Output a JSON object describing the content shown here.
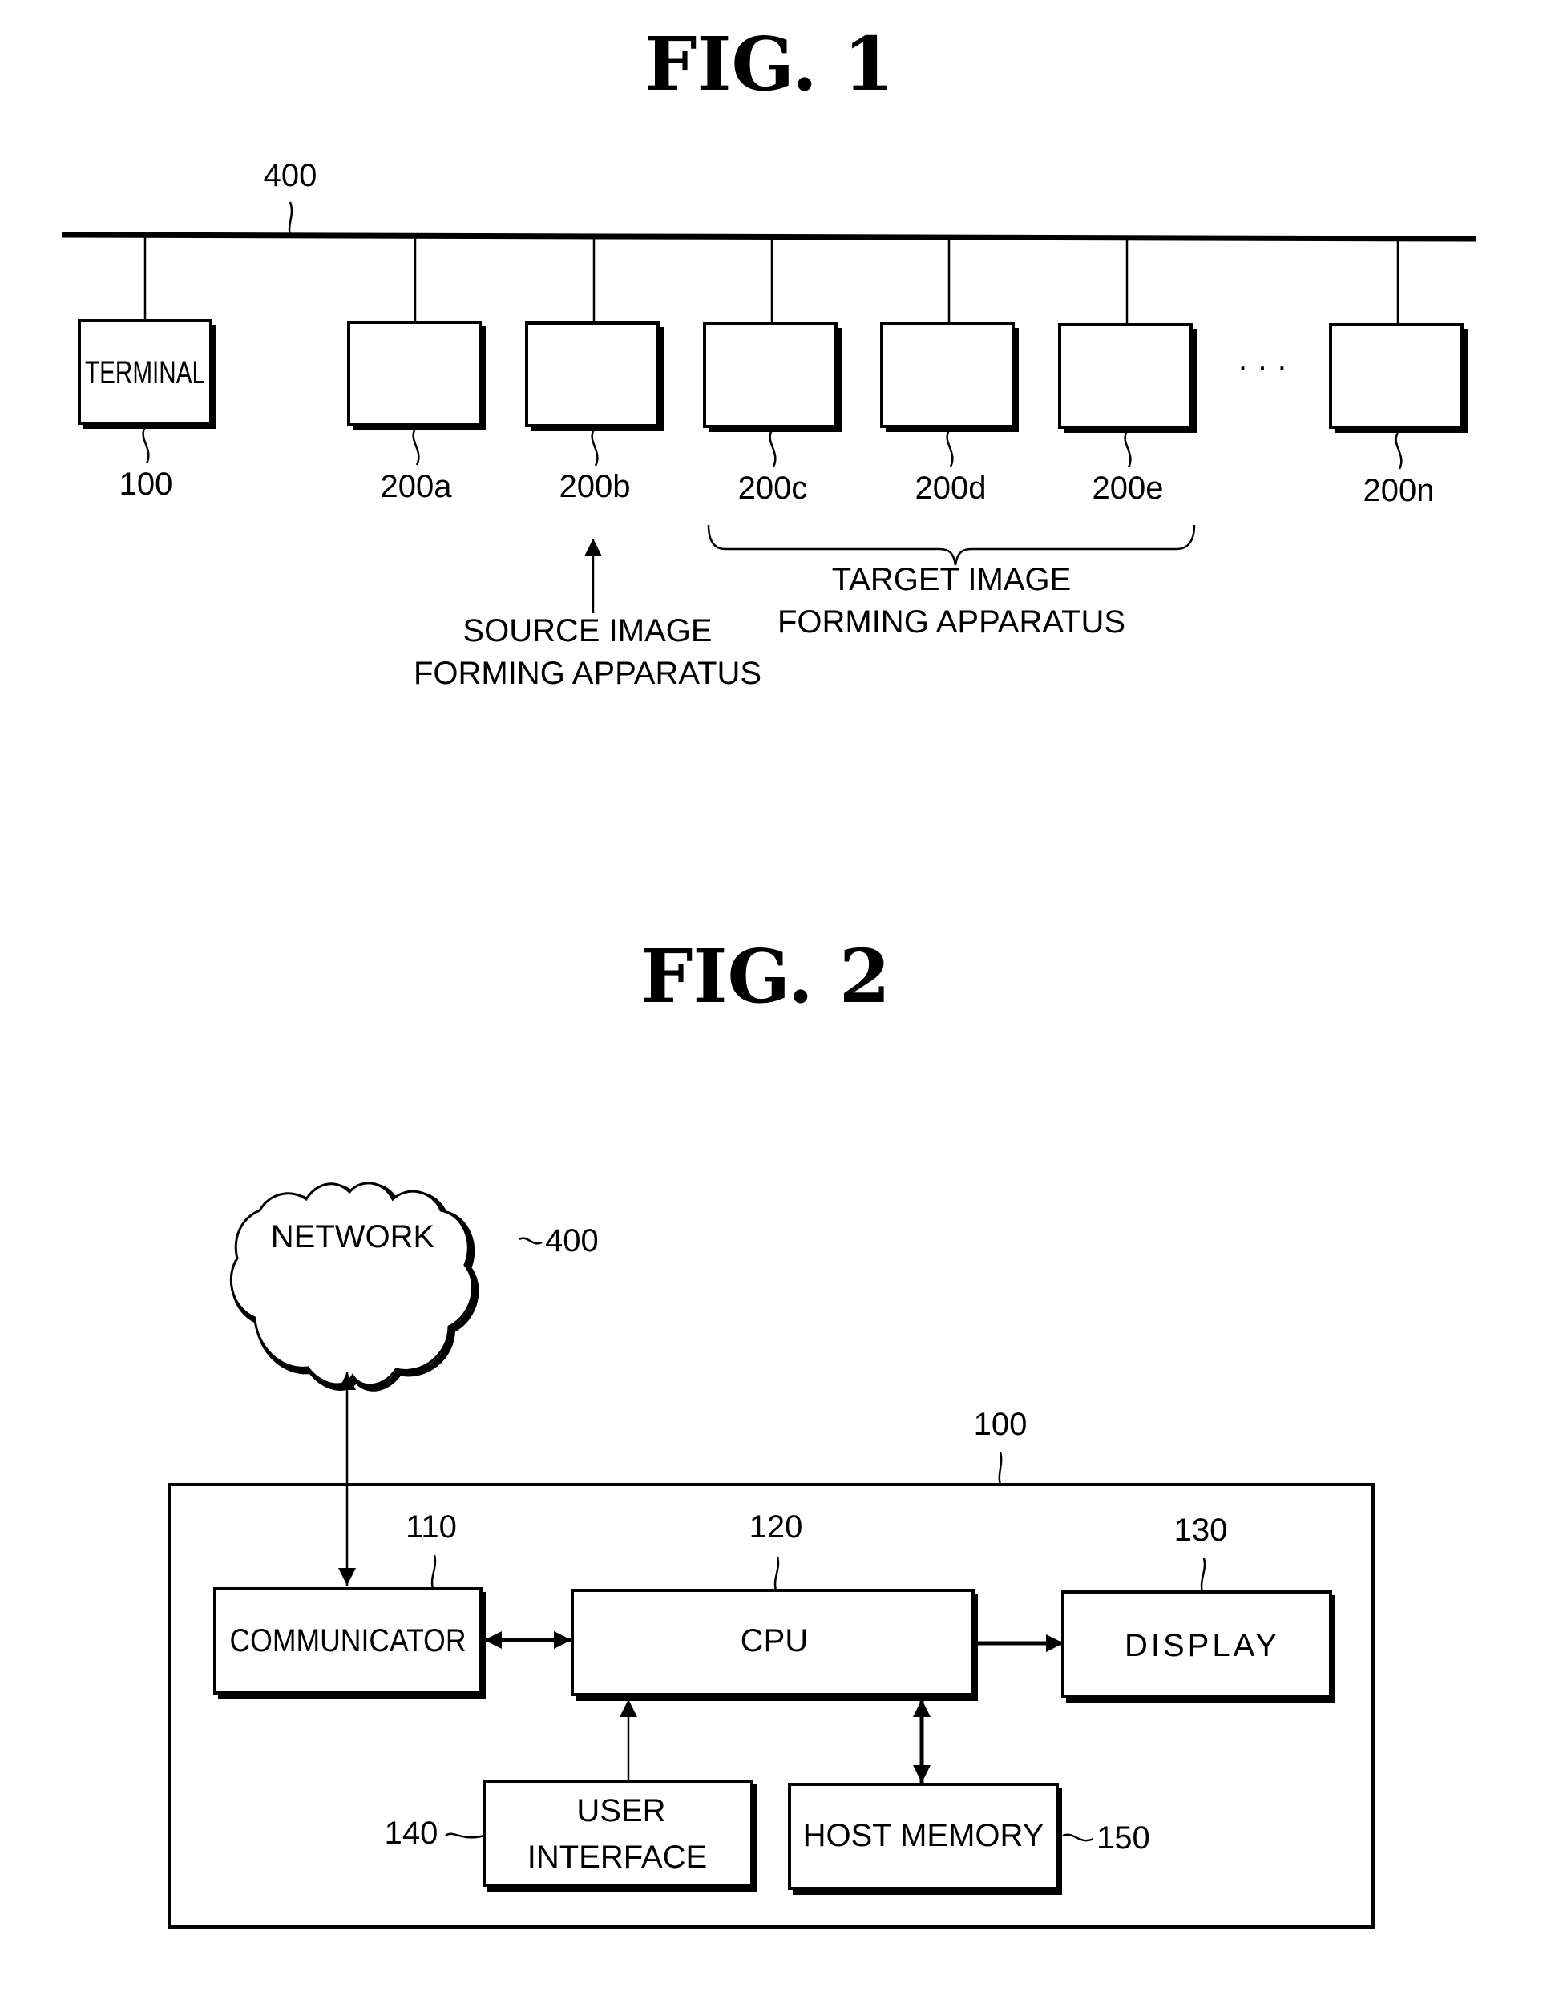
{
  "fig1": {
    "title": "FIG. 1",
    "network_ref": "400",
    "nodes": [
      {
        "label": "TERMINAL",
        "ref": "100"
      },
      {
        "label": "",
        "ref": "200a"
      },
      {
        "label": "",
        "ref": "200b"
      },
      {
        "label": "",
        "ref": "200c"
      },
      {
        "label": "",
        "ref": "200d"
      },
      {
        "label": "",
        "ref": "200e"
      },
      {
        "label": "",
        "ref": "200n"
      }
    ],
    "ellipsis": "· · ·",
    "source_annotation": {
      "line1": "SOURCE  IMAGE",
      "line2": "FORMING APPARATUS"
    },
    "target_annotation": {
      "line1": "TARGET  IMAGE",
      "line2": "FORMING APPARATUS"
    }
  },
  "fig2": {
    "title": "FIG. 2",
    "network": {
      "label": "NETWORK",
      "ref": "400"
    },
    "terminal_ref": "100",
    "blocks": {
      "communicator": {
        "label": "COMMUNICATOR",
        "ref": "110"
      },
      "cpu": {
        "label": "CPU",
        "ref": "120"
      },
      "display": {
        "label": "DISPLAY",
        "ref": "130"
      },
      "user_interface": {
        "line1": "USER",
        "line2": "INTERFACE",
        "ref": "140"
      },
      "host_memory": {
        "label": "HOST  MEMORY",
        "ref": "150"
      }
    }
  }
}
